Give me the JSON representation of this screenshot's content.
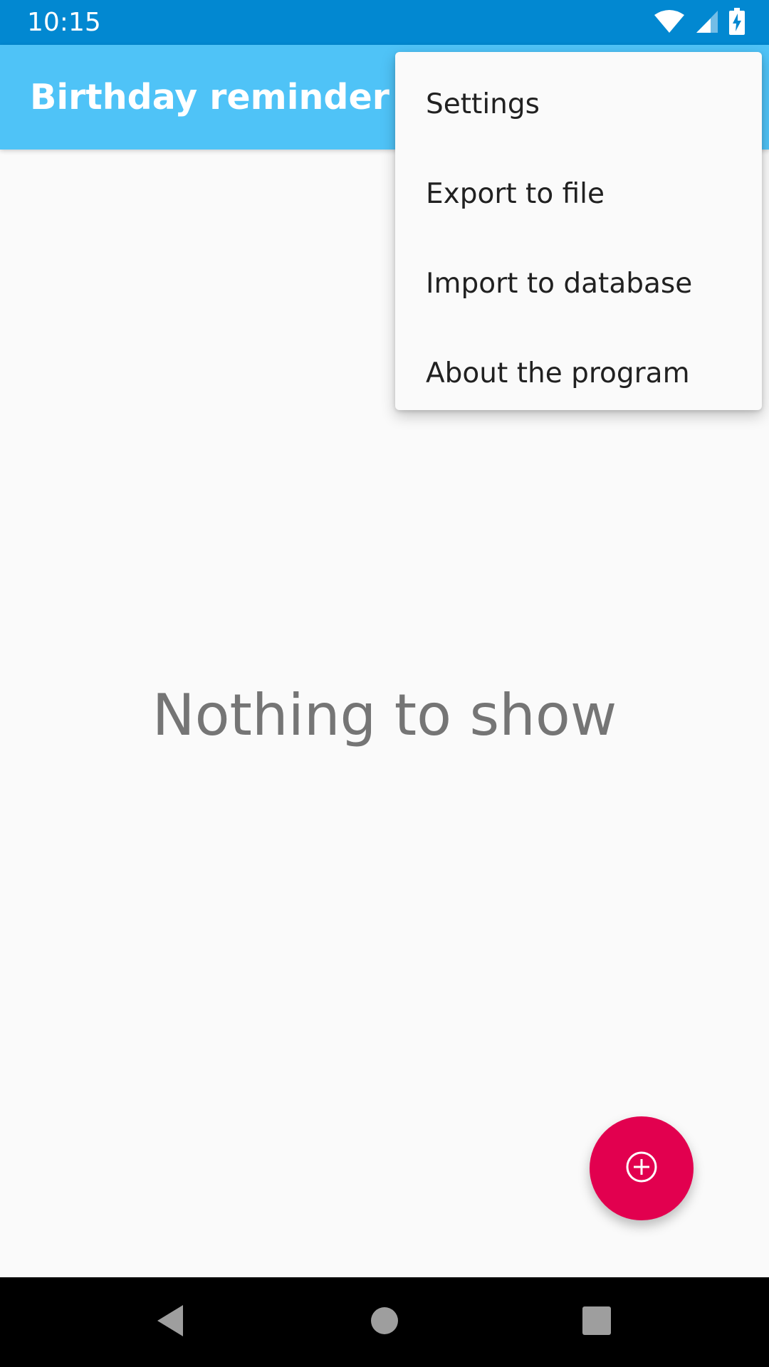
{
  "status_bar": {
    "time": "10:15",
    "icons": [
      "wifi-icon",
      "cell-signal-icon",
      "battery-charging-icon"
    ]
  },
  "app_bar": {
    "title": "Birthday reminder",
    "color": "#4FC3F7"
  },
  "overflow_menu": {
    "items": [
      {
        "label": "Settings"
      },
      {
        "label": "Export to file"
      },
      {
        "label": "Import to database"
      },
      {
        "label": "About the program"
      }
    ]
  },
  "main": {
    "empty_message": "Nothing to show"
  },
  "fab": {
    "icon": "add-circle-icon",
    "color": "#E2004F"
  },
  "nav_bar": {
    "buttons": [
      "back-icon",
      "home-icon",
      "recents-icon"
    ]
  }
}
